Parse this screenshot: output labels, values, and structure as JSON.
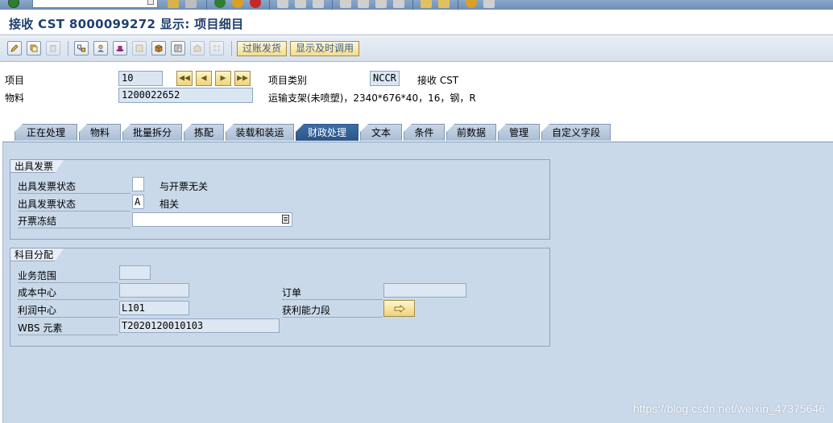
{
  "window": {
    "title": "接收 CST 8000099272 显示: 项目细目"
  },
  "app_toolbar": {
    "buttons": [
      {
        "icon": "edit-pencil-icon"
      },
      {
        "icon": "copy-structure-icon"
      },
      {
        "icon": "delete-trash-icon",
        "disabled": true
      },
      {
        "icon": "document-flow-icon"
      },
      {
        "icon": "partner-icon"
      },
      {
        "icon": "status-hat-icon"
      },
      {
        "icon": "output-icon",
        "disabled": true
      },
      {
        "icon": "package-icon"
      },
      {
        "icon": "texts-icon"
      },
      {
        "icon": "conditions-icon",
        "disabled": true
      },
      {
        "icon": "grid-icon",
        "disabled": true
      }
    ],
    "text_buttons": [
      "过账发货",
      "显示及时调用"
    ]
  },
  "header": {
    "item_label": "项目",
    "item_value": "10",
    "item_category_label": "项目类别",
    "item_category_value": "NCCR",
    "item_category_desc": "接收 CST",
    "material_label": "物料",
    "material_value": "1200022652",
    "material_desc": "运输支架(未喷塑)，2340*676*40，16，钢，R"
  },
  "tabs": [
    {
      "label": "正在处理",
      "active": false
    },
    {
      "label": "物料",
      "active": false
    },
    {
      "label": "批量拆分",
      "active": false
    },
    {
      "label": "拣配",
      "active": false
    },
    {
      "label": "装载和装运",
      "active": false
    },
    {
      "label": "财政处理",
      "active": true
    },
    {
      "label": "文本",
      "active": false
    },
    {
      "label": "条件",
      "active": false
    },
    {
      "label": "前数据",
      "active": false
    },
    {
      "label": "管理",
      "active": false
    },
    {
      "label": "自定义字段",
      "active": false
    }
  ],
  "billing_group": {
    "title": "出具发票",
    "row1_label": "出具发票状态",
    "row1_value": "",
    "row1_desc": "与开票无关",
    "row2_label": "出具发票状态",
    "row2_value": "A",
    "row2_desc": "相关",
    "row3_label": "开票冻结",
    "row3_value": ""
  },
  "account_group": {
    "title": "科目分配",
    "business_area_label": "业务范围",
    "business_area_value": "",
    "cost_center_label": "成本中心",
    "cost_center_value": "",
    "order_label": "订单",
    "order_value": "",
    "profit_center_label": "利润中心",
    "profit_center_value": "L101",
    "profitability_label": "获利能力段",
    "wbs_label": "WBS 元素",
    "wbs_value": "T2020120010103"
  },
  "watermark": "https://blog.csdn.net/weixin_47375646"
}
